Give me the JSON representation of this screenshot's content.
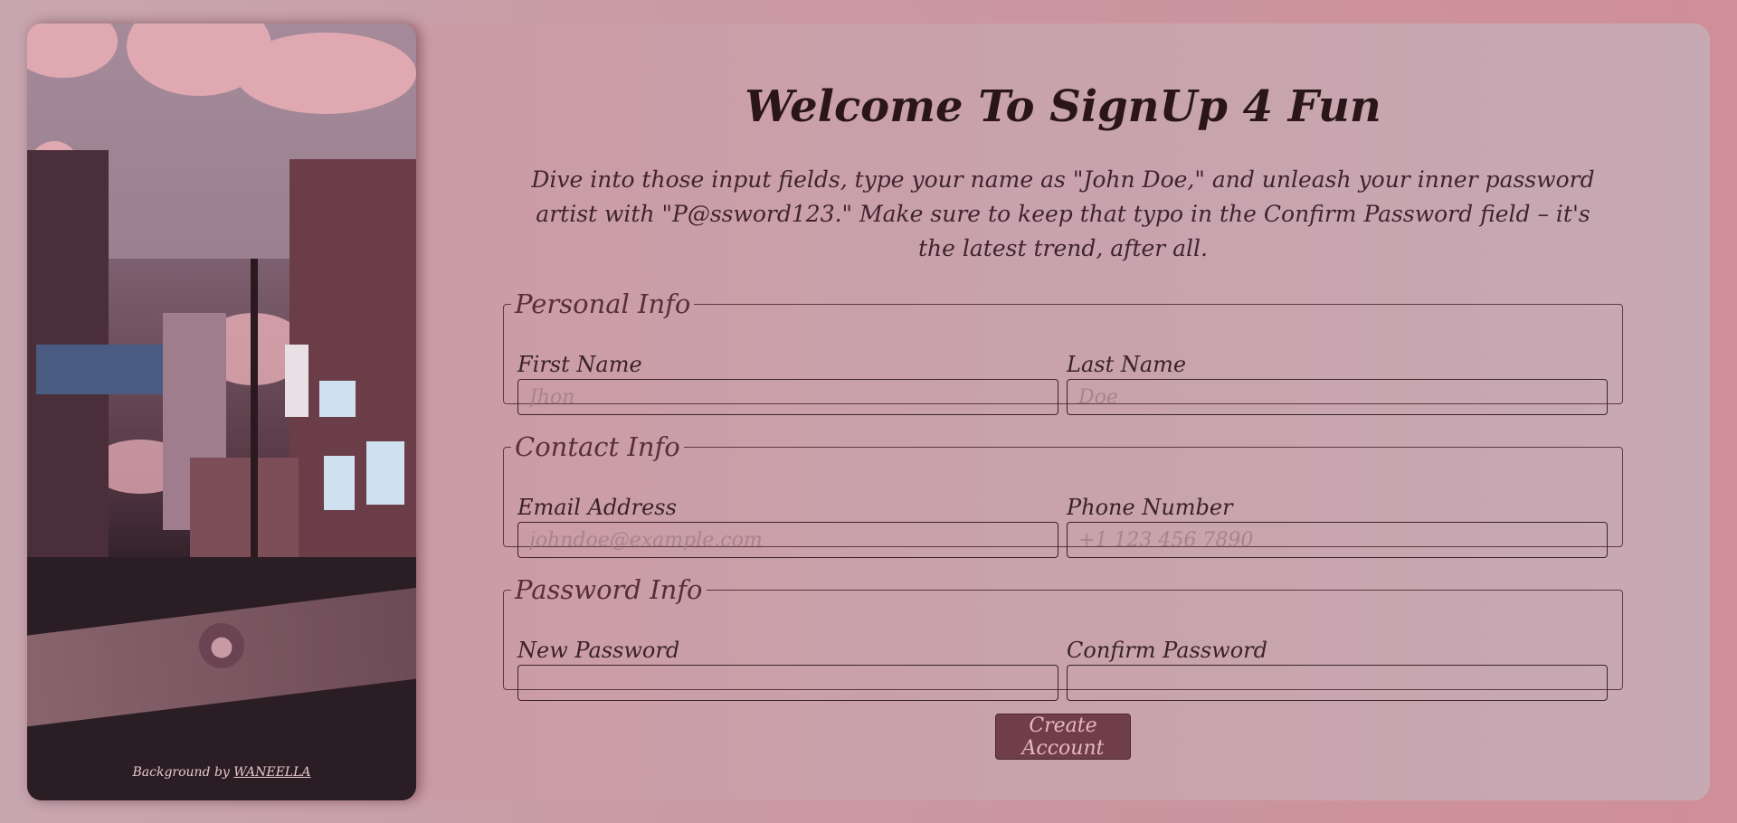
{
  "art": {
    "credit_prefix": "Background by",
    "credit_link": "WANEELLA",
    "sign_text": "WANEELLA",
    "github_icon": "github-icon"
  },
  "header": {
    "title": "Welcome To SignUp 4 Fun",
    "description": "Dive into those input fields, type your name as \"John Doe,\" and unleash your inner password artist with \"P@ssword123.\" Make sure to keep that typo in the Confirm Password field – it's the latest trend, after all."
  },
  "sections": {
    "personal": {
      "legend": "Personal Info",
      "first_name": {
        "label": "First Name",
        "placeholder": "Jhon"
      },
      "last_name": {
        "label": "Last Name",
        "placeholder": "Doe"
      }
    },
    "contact": {
      "legend": "Contact Info",
      "email": {
        "label": "Email Address",
        "placeholder": "johndoe@example.com"
      },
      "phone": {
        "label": "Phone Number",
        "placeholder": "+1 123 456 7890"
      }
    },
    "password": {
      "legend": "Password Info",
      "new_password": {
        "label": "New Password",
        "placeholder": ""
      },
      "confirm_password": {
        "label": "Confirm Password",
        "placeholder": ""
      }
    }
  },
  "actions": {
    "create_label": "Create Account"
  }
}
